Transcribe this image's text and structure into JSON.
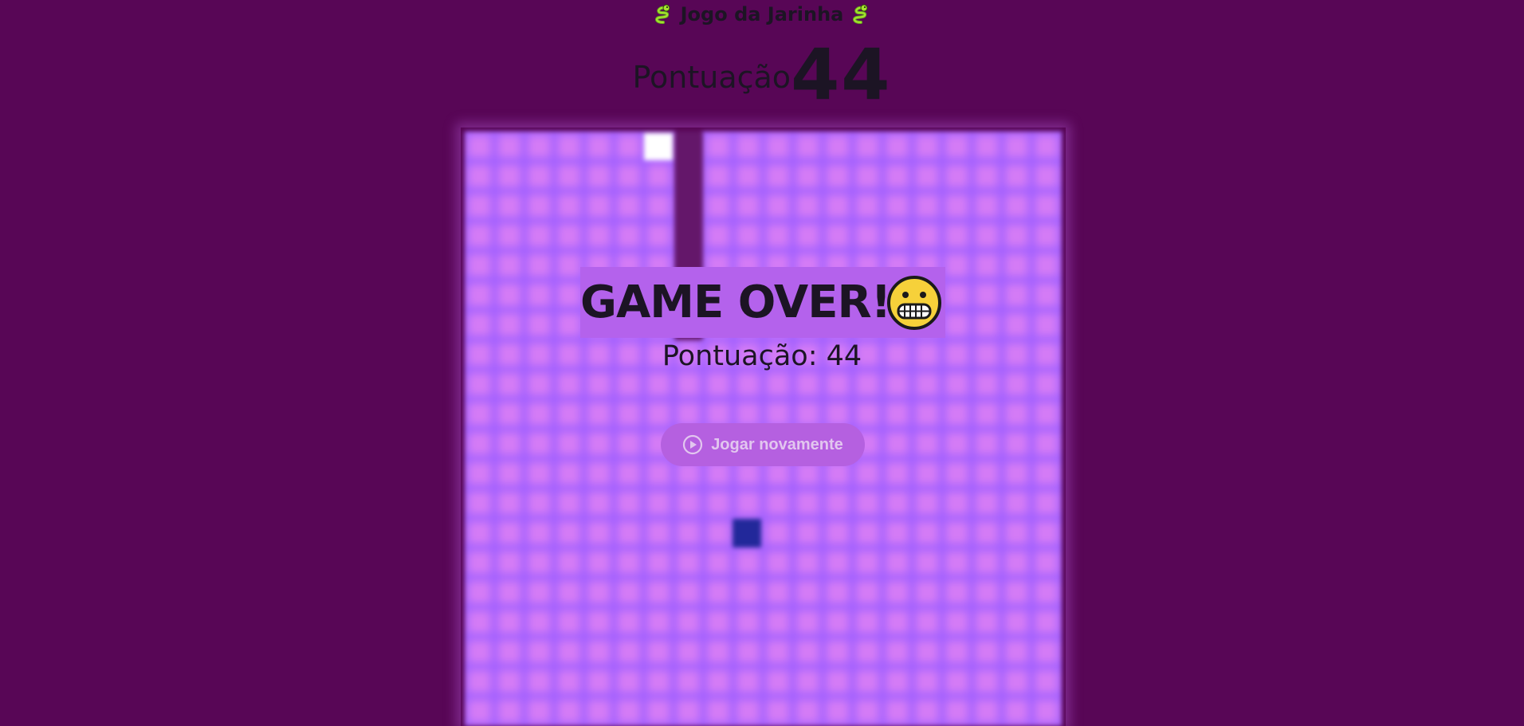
{
  "header": {
    "title": "Jogo da Jarinha",
    "title_icon": "snake-emoji"
  },
  "score": {
    "label": "Pontuação",
    "value": "44"
  },
  "board": {
    "colors": {
      "background": "#d47bf6",
      "cell_border": "#a05fff",
      "snake_head": "#ffffff",
      "snake_body": "#64176a",
      "food": "#22289a"
    }
  },
  "game_over": {
    "title": "GAME OVER!",
    "icon": "grimacing-face-emoji",
    "final_score": "Pontuação: 44",
    "play_again_label": "Jogar novamente",
    "play_again_icon": "play-circle-icon"
  },
  "colors": {
    "page_background": "#580656",
    "text": "#1c1424",
    "overlay_title_background": "#b462ec",
    "button_background": "#b560e0",
    "button_text": "#e2c6ef"
  }
}
